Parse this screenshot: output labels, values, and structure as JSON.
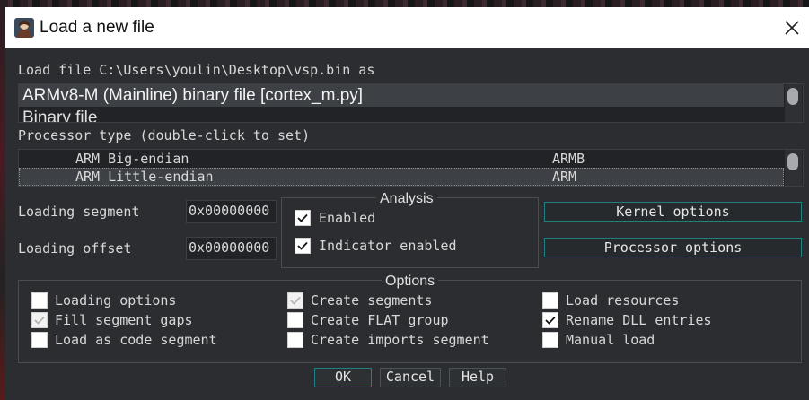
{
  "window": {
    "title": "Load a new file"
  },
  "load_as": {
    "label": "Load file C:\\Users\\youlin\\Desktop\\vsp.bin as",
    "items": [
      "ARMv8-M (Mainline) binary file [cortex_m.py]",
      "Binary file"
    ]
  },
  "processor": {
    "label": "Processor type (double-click to set)",
    "rows": [
      {
        "name": "ARM Big-endian",
        "code": "ARMB"
      },
      {
        "name": "ARM Little-endian",
        "code": "ARM"
      }
    ]
  },
  "segment": {
    "label": "Loading segment",
    "value": "0x00000000"
  },
  "offset": {
    "label": "Loading offset",
    "value": "0x00000000"
  },
  "analysis": {
    "title": "Analysis",
    "enabled": {
      "label": "Enabled",
      "checked": true
    },
    "indicator": {
      "label": "Indicator enabled",
      "checked": true
    }
  },
  "buttons": {
    "kernel": "Kernel options",
    "processor": "Processor options",
    "ok": "OK",
    "cancel": "Cancel",
    "help": "Help"
  },
  "options": {
    "title": "Options",
    "col1": [
      {
        "label": "Loading options",
        "state": "unchecked"
      },
      {
        "label": "Fill segment gaps",
        "state": "disabled-checked"
      },
      {
        "label": "Load as code segment",
        "state": "unchecked"
      }
    ],
    "col2": [
      {
        "label": "Create segments",
        "state": "disabled-checked"
      },
      {
        "label": "Create FLAT group",
        "state": "unchecked"
      },
      {
        "label": "Create imports segment",
        "state": "unchecked"
      }
    ],
    "col3": [
      {
        "label": "Load resources",
        "state": "unchecked"
      },
      {
        "label": "Rename DLL entries",
        "state": "checked"
      },
      {
        "label": "Manual load",
        "state": "unchecked"
      }
    ]
  }
}
